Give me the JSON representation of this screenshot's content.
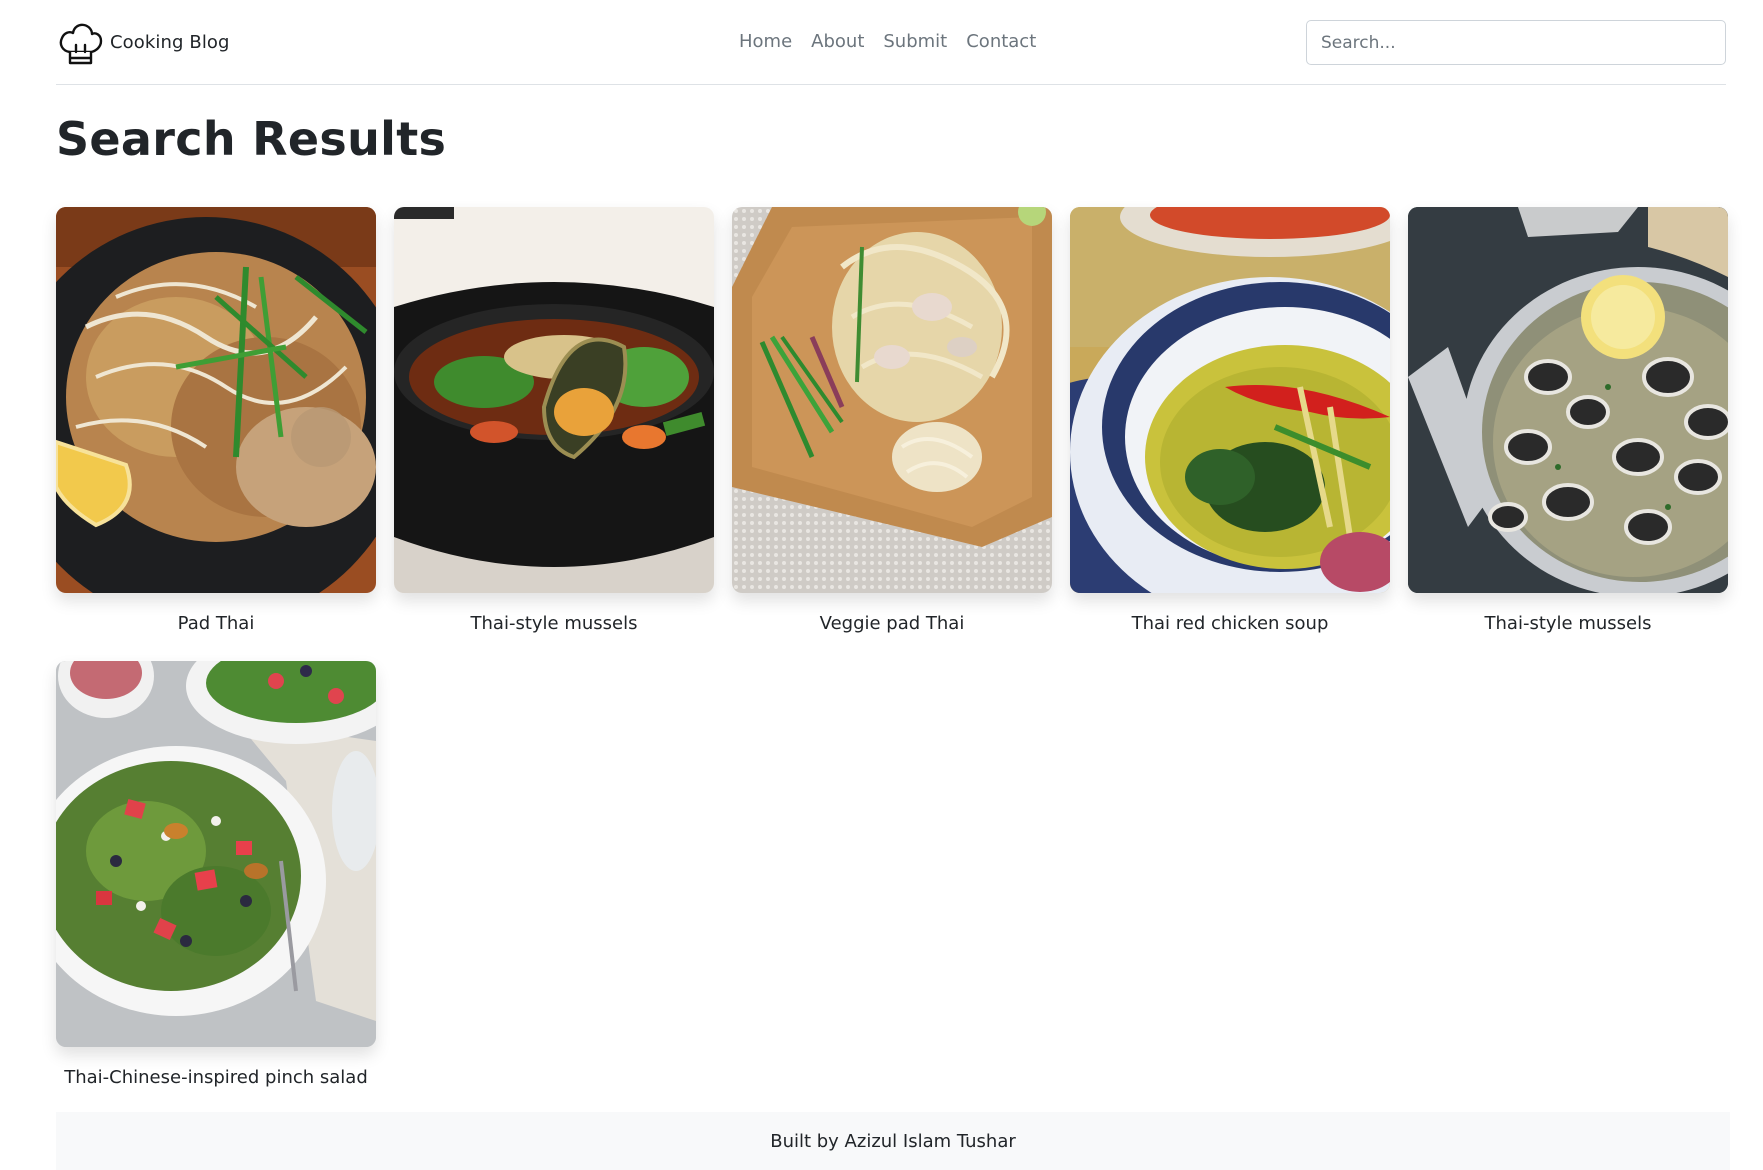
{
  "header": {
    "brand": "Cooking Blog",
    "nav": [
      "Home",
      "About",
      "Submit",
      "Contact"
    ],
    "search_placeholder": "Search..."
  },
  "main": {
    "title": "Search Results",
    "results": [
      {
        "title": "Pad Thai"
      },
      {
        "title": "Thai-style mussels"
      },
      {
        "title": "Veggie pad Thai"
      },
      {
        "title": "Thai red chicken soup"
      },
      {
        "title": "Thai-style mussels"
      },
      {
        "title": "Thai-Chinese-inspired pinch salad"
      }
    ]
  },
  "footer": {
    "text": "Built by Azizul Islam Tushar"
  }
}
